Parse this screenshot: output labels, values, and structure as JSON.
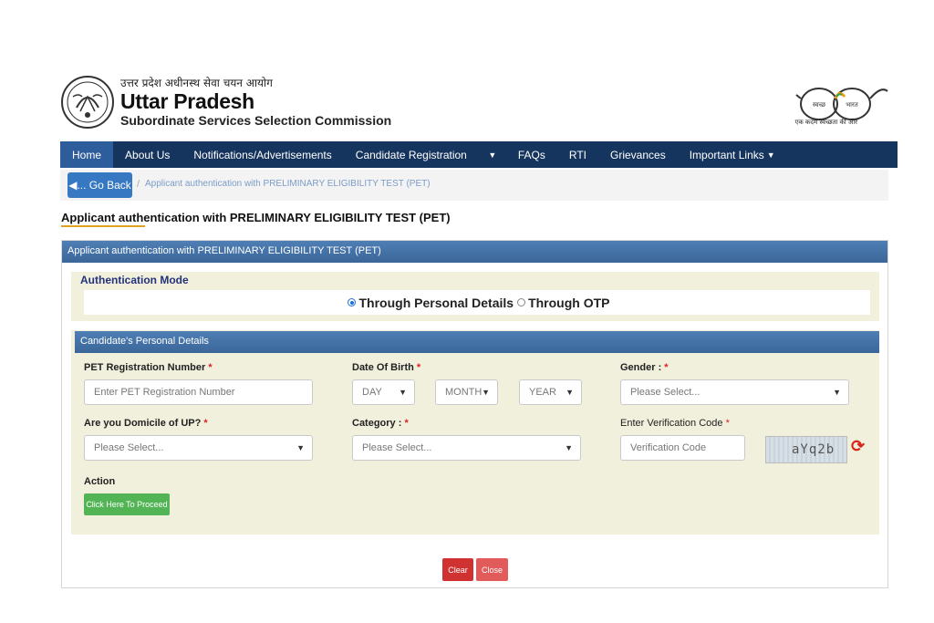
{
  "header": {
    "hindi_title": "उत्तर प्रदेश अधीनस्थ सेवा चयन आयोग",
    "title": "Uttar Pradesh",
    "subtitle": "Subordinate Services Selection Commission",
    "swachh_left": "स्वच्छ",
    "swachh_right": "भारत",
    "swachh_caption": "एक कदम स्वच्छता की ओर"
  },
  "nav": {
    "items": [
      "Home",
      "About Us",
      "Notifications/Advertisements",
      "Candidate Registration",
      "FAQs",
      "RTI",
      "Grievances",
      "Important Links"
    ],
    "active": "Home"
  },
  "breadcrumb": {
    "back_label": "... Go Back",
    "current": "Applicant authentication with PRELIMINARY ELIGIBILITY TEST (PET)"
  },
  "page": {
    "title": "Applicant authentication with PRELIMINARY ELIGIBILITY TEST (PET)",
    "panel_heading": "Applicant authentication with PRELIMINARY ELIGIBILITY TEST (PET)"
  },
  "auth_mode": {
    "legend": "Authentication Mode",
    "option_personal": "Through Personal Details",
    "option_otp": "Through OTP",
    "selected": "personal"
  },
  "form": {
    "section_heading": "Candidate's Personal Details",
    "pet_label": "PET Registration Number",
    "pet_placeholder": "Enter PET Registration Number",
    "dob_label": "Date Of Birth",
    "day_value": "DAY",
    "month_value": "MONTH",
    "year_value": "YEAR",
    "gender_label": "Gender :",
    "gender_value": "Please Select...",
    "domicile_label": "Are you Domicile of UP?",
    "domicile_value": "Please Select...",
    "category_label": "Category :",
    "category_value": "Please Select...",
    "verification_label": "Enter Verification Code",
    "verification_placeholder": "Verification Code",
    "captcha_text": "aYq2b",
    "action_label": "Action",
    "proceed_label": "Click Here To Proceed",
    "required_mark": "*"
  },
  "footer": {
    "clear_label": "Clear",
    "close_label": "Close"
  },
  "colors": {
    "nav_bg": "#16355e",
    "nav_active": "#2d5d9a",
    "panel_heading": "#3b6699",
    "form_bg": "#f1f0dd",
    "proceed": "#53b455",
    "clear": "#d03232",
    "close": "#e05b59"
  },
  "icons": {
    "back": "double-chevron-left-icon",
    "refresh": "refresh-icon",
    "caret": "chevron-down-icon"
  }
}
